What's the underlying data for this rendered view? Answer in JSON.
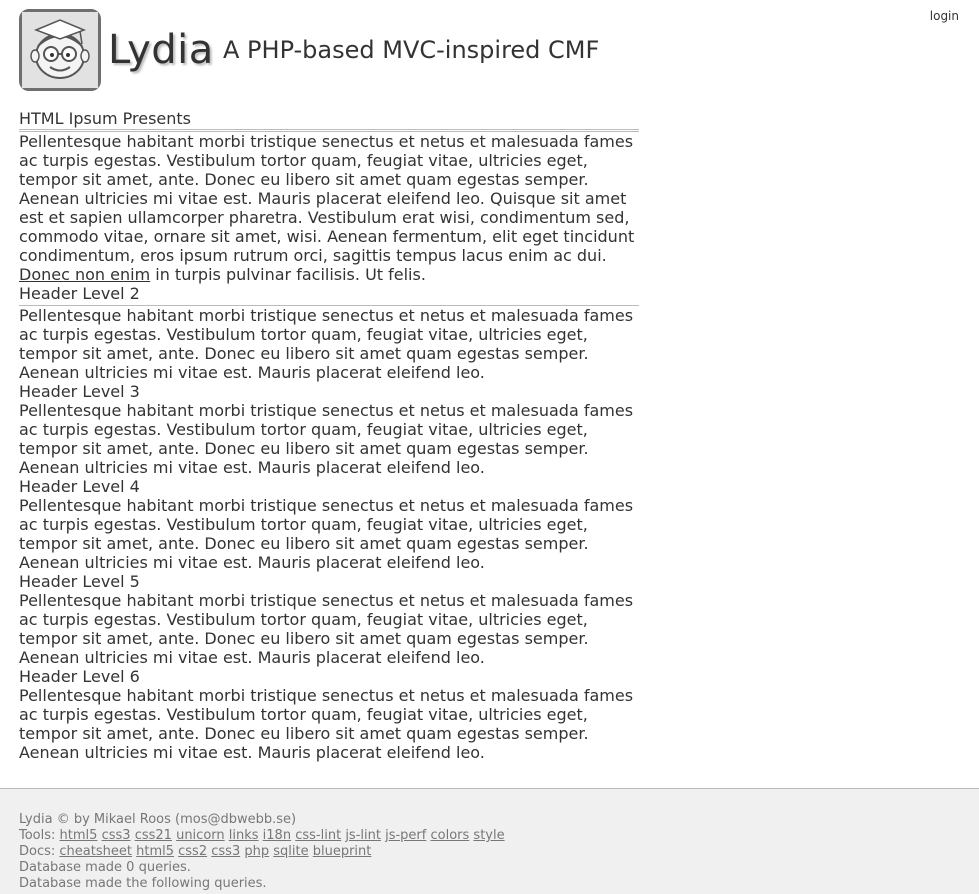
{
  "header": {
    "site_title": "Lydia",
    "slogan": "A PHP-based MVC-inspired CMF",
    "login_label": "login",
    "logo_icon": "lydia-logo-icon"
  },
  "main": {
    "title": "HTML Ipsum Presents",
    "intro": {
      "before": "Pellentesque habitant morbi tristique senectus et netus et malesuada fames ac turpis egestas. Vestibulum tortor quam, feugiat vitae, ultricies eget, tempor sit amet, ante. Donec eu libero sit amet quam egestas semper. Aenean ultricies mi vitae est. Mauris placerat eleifend leo. Quisque sit amet est et sapien ullamcorper pharetra. Vestibulum erat wisi, condimentum sed, commodo vitae, ornare sit amet, wisi. Aenean fermentum, elit eget tincidunt condimentum, eros ipsum rutrum orci, sagittis tempus lacus enim ac dui.",
      "link": "Donec non enim",
      "after": "in turpis pulvinar facilisis. Ut felis."
    },
    "sections": [
      {
        "heading": "Header Level 2",
        "text": "Pellentesque habitant morbi tristique senectus et netus et malesuada fames ac turpis egestas. Vestibulum tortor quam, feugiat vitae, ultricies eget, tempor sit amet, ante. Donec eu libero sit amet quam egestas semper. Aenean ultricies mi vitae est. Mauris placerat eleifend leo."
      },
      {
        "heading": "Header Level 3",
        "text": "Pellentesque habitant morbi tristique senectus et netus et malesuada fames ac turpis egestas. Vestibulum tortor quam, feugiat vitae, ultricies eget, tempor sit amet, ante. Donec eu libero sit amet quam egestas semper. Aenean ultricies mi vitae est. Mauris placerat eleifend leo."
      },
      {
        "heading": "Header Level 4",
        "text": "Pellentesque habitant morbi tristique senectus et netus et malesuada fames ac turpis egestas. Vestibulum tortor quam, feugiat vitae, ultricies eget, tempor sit amet, ante. Donec eu libero sit amet quam egestas semper. Aenean ultricies mi vitae est. Mauris placerat eleifend leo."
      },
      {
        "heading": "Header Level 5",
        "text": "Pellentesque habitant morbi tristique senectus et netus et malesuada fames ac turpis egestas. Vestibulum tortor quam, feugiat vitae, ultricies eget, tempor sit amet, ante. Donec eu libero sit amet quam egestas semper. Aenean ultricies mi vitae est. Mauris placerat eleifend leo."
      },
      {
        "heading": "Header Level 6",
        "text": "Pellentesque habitant morbi tristique senectus et netus et malesuada fames ac turpis egestas. Vestibulum tortor quam, feugiat vitae, ultricies eget, tempor sit amet, ante. Donec eu libero sit amet quam egestas semper. Aenean ultricies mi vitae est. Mauris placerat eleifend leo."
      }
    ]
  },
  "footer": {
    "copyright": "Lydia © by Mikael Roos (mos@dbwebb.se)",
    "tools_label": "Tools:",
    "tools": [
      "html5",
      "css3",
      "css21",
      "unicorn",
      "links",
      "i18n",
      "css-lint",
      "js-lint",
      "js-perf",
      "colors",
      "style"
    ],
    "docs_label": "Docs:",
    "docs": [
      "cheatsheet",
      "html5",
      "css2",
      "css3",
      "php",
      "sqlite",
      "blueprint"
    ],
    "db_queries": "Database made 0 queries.",
    "db_following": "Database made the following queries."
  }
}
